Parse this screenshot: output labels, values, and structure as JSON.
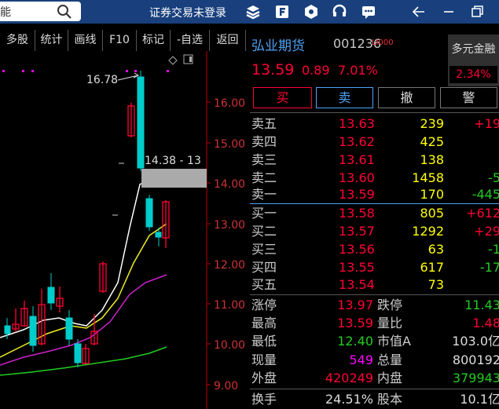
{
  "topbar": {
    "search_text": "能",
    "login_text": "证券交易未登录"
  },
  "toolbar": {
    "items": [
      "多股",
      "统计",
      "画线",
      "F10",
      "标记",
      "-自选",
      "返回"
    ]
  },
  "chart": {
    "high_label": "16.78",
    "tip_label": "14.38 - 13",
    "y_ticks": [
      "16.00",
      "15.00",
      "14.00",
      "13.00",
      "12.00",
      "11.00",
      "10.00",
      "9.00"
    ]
  },
  "quote": {
    "name": "弘业期货",
    "code": "001236",
    "tag": "LI000",
    "concept": "多元金融",
    "concept_pct": "2.34%",
    "price": "13.59",
    "change": "0.89",
    "pct": "7.01%",
    "buttons": {
      "buy": "买",
      "sell": "卖",
      "cancel": "撤",
      "alert": "警"
    },
    "asks": [
      {
        "label": "卖五",
        "price": "13.63",
        "vol": "239",
        "delta": "+19"
      },
      {
        "label": "卖四",
        "price": "13.62",
        "vol": "425",
        "delta": ""
      },
      {
        "label": "卖三",
        "price": "13.61",
        "vol": "138",
        "delta": ""
      },
      {
        "label": "卖二",
        "price": "13.60",
        "vol": "1458",
        "delta": "-5"
      },
      {
        "label": "卖一",
        "price": "13.59",
        "vol": "170",
        "delta": "-445"
      }
    ],
    "bids": [
      {
        "label": "买一",
        "price": "13.58",
        "vol": "805",
        "delta": "+612"
      },
      {
        "label": "买二",
        "price": "13.57",
        "vol": "1292",
        "delta": "+29"
      },
      {
        "label": "买三",
        "price": "13.56",
        "vol": "63",
        "delta": "-1"
      },
      {
        "label": "买四",
        "price": "13.55",
        "vol": "617",
        "delta": "-17"
      },
      {
        "label": "买五",
        "price": "13.54",
        "vol": "73",
        "delta": ""
      }
    ],
    "stats": {
      "limit_up_l": "涨停",
      "limit_up": "13.97",
      "limit_down_l": "跌停",
      "limit_down": "11.43",
      "high_l": "最高",
      "high": "13.59",
      "vol_ratio_l": "量比",
      "vol_ratio": "1.48",
      "low_l": "最低",
      "low": "12.40",
      "mcap_l": "市值A",
      "mcap": "103.0亿",
      "cur_l": "现量",
      "cur": "549",
      "total_l": "总量",
      "total": "800192",
      "outer_l": "外盘",
      "outer": "420249",
      "inner_l": "内盘",
      "inner": "379943",
      "turnover_l": "换手",
      "turnover": "24.51%",
      "equity_l": "股本",
      "equity": "10.1亿"
    }
  }
}
